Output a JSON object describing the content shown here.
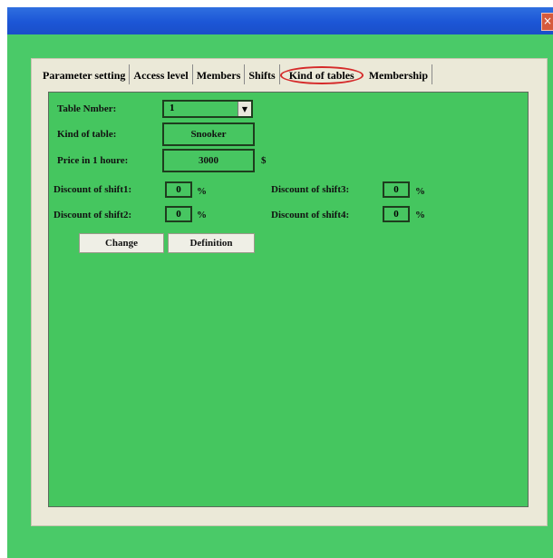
{
  "window": {
    "close_symbol": "×"
  },
  "tabs": [
    {
      "label": "Parameter setting"
    },
    {
      "label": "Access level"
    },
    {
      "label": "Members"
    },
    {
      "label": "Shifts"
    },
    {
      "label": "Kind of tables"
    },
    {
      "label": "Membership"
    }
  ],
  "form": {
    "table_number": {
      "label": "Table Nmber:",
      "value": "1"
    },
    "kind_of_table": {
      "label": "Kind of table:",
      "value": "Snooker"
    },
    "price": {
      "label": "Price in  1 houre:",
      "value": "3000",
      "unit": "$"
    },
    "discounts": [
      {
        "label": "Discount of shift1:",
        "value": "0",
        "unit": "%"
      },
      {
        "label": "Discount of shift2:",
        "value": "0",
        "unit": "%"
      },
      {
        "label": "Discount of shift3:",
        "value": "0",
        "unit": "%"
      },
      {
        "label": "Discount of shift4:",
        "value": "0",
        "unit": "%"
      }
    ],
    "buttons": {
      "change": "Change",
      "definition": "Definition"
    }
  },
  "colors": {
    "window_bg": "#4aca68",
    "tab_body_bg": "#45c65f",
    "panel_bg": "#ebe9d8",
    "highlight_ring": "#d52a2a",
    "titlebar": "#1c56d6"
  },
  "icons": {
    "close": "close-icon",
    "dropdown": "chevron-down-icon"
  }
}
